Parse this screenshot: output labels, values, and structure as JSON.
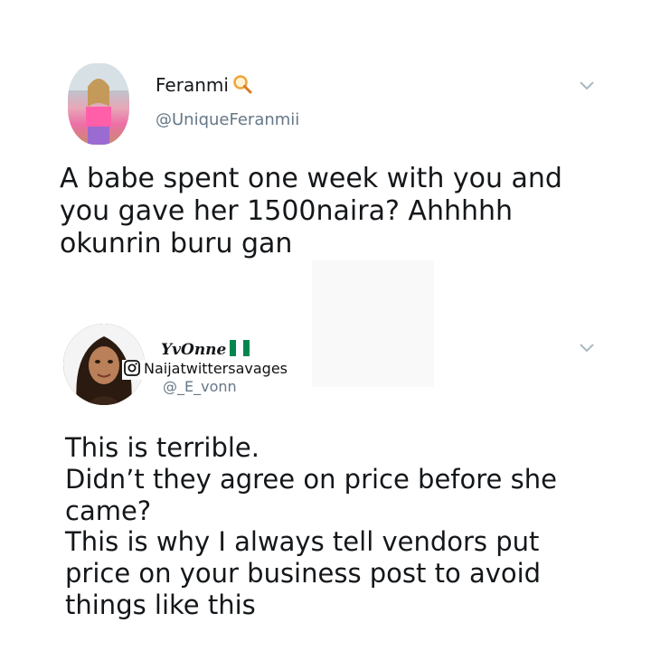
{
  "tweets": [
    {
      "display_name": "Feranmi",
      "name_emoji": "magnifying-glass-emoji",
      "handle": "@UniqueFeranmii",
      "text_lines": [
        "A babe spent one week with you and",
        "you gave her 1500naira? Ahhhhh",
        "okunrin buru gan"
      ]
    },
    {
      "display_name": "YvOnne",
      "name_emoji": "nigeria-flag-emoji",
      "handle": "@_E_vonn",
      "text_lines": [
        "This is terrible.",
        "Didn’t they agree on price before she",
        "came?",
        "This is why I always tell vendors put",
        "price on your business post to avoid",
        "things like this"
      ]
    }
  ],
  "watermark": {
    "icon": "instagram-icon",
    "text": "Naijatwittersavages"
  },
  "colors": {
    "text": "#14171a",
    "handle": "#657786",
    "chevron": "#aab8c2",
    "flag_green": "#008751"
  }
}
